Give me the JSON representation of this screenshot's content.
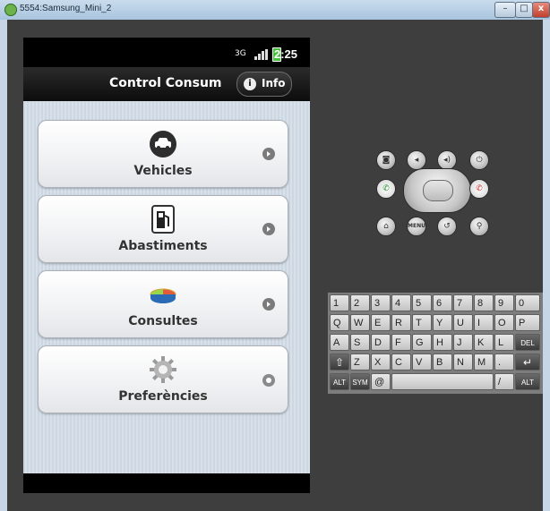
{
  "window": {
    "title": "5554:Samsung_Mini_2"
  },
  "status_bar": {
    "network": "3G",
    "time": "2:25"
  },
  "action_bar": {
    "title": "Control Consum",
    "info_label": "Info"
  },
  "menu": {
    "items": [
      {
        "label": "Vehicles",
        "icon": "car-icon"
      },
      {
        "label": "Abastiments",
        "icon": "fuel-pump-icon"
      },
      {
        "label": "Consultes",
        "icon": "pie-chart-icon"
      },
      {
        "label": "Preferències",
        "icon": "gear-icon"
      }
    ]
  },
  "controls": {
    "menu_label": "MENU"
  },
  "keyboard": {
    "rows": [
      [
        "1",
        "2",
        "3",
        "4",
        "5",
        "6",
        "7",
        "8",
        "9",
        "0"
      ],
      [
        "Q",
        "W",
        "E",
        "R",
        "T",
        "Y",
        "U",
        "I",
        "O",
        "P"
      ],
      [
        "A",
        "S",
        "D",
        "F",
        "G",
        "H",
        "J",
        "K",
        "L",
        "DEL"
      ],
      [
        "Z",
        "X",
        "C",
        "V",
        "B",
        "N",
        "M",
        ".",
        "↵"
      ],
      [
        "ALT",
        "SYM",
        "@",
        "",
        "/",
        "ALT"
      ]
    ]
  }
}
